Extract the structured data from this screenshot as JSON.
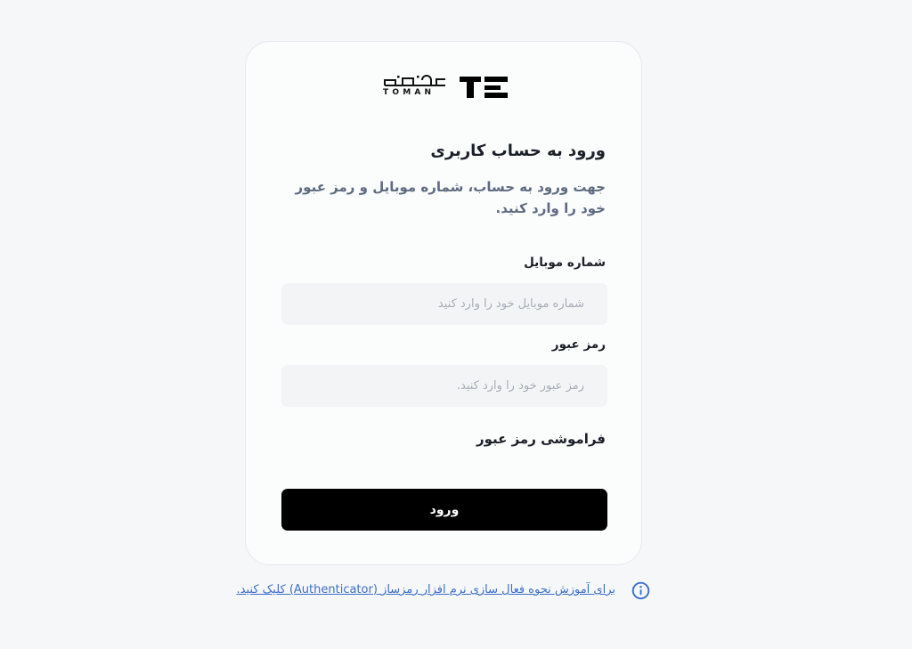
{
  "brand": {
    "name_fa": "تومن",
    "name_en": "TOMAN"
  },
  "login": {
    "title": "ورود به حساب کاربری",
    "subtitle": "جهت ورود به حساب، شماره موبایل و رمز عبور خود را وارد کنید.",
    "mobile": {
      "label": "شماره موبایل",
      "placeholder": "شماره موبایل خود را وارد کنید",
      "value": ""
    },
    "password": {
      "label": "رمز عبور",
      "placeholder": "رمز عبور خود را وارد کنید.",
      "value": ""
    },
    "forgot_label": "فراموشی رمز عبور",
    "submit_label": "ورود"
  },
  "help": {
    "icon": "info-icon",
    "link_text": "برای آموزش نحوه فعال سازی نرم افزار رمزساز (Authenticator) کلیک کنید.",
    "color": "#3d6fc8"
  },
  "colors": {
    "background": "#f6f7f9",
    "card": "#fbfcfc",
    "button": "#000000",
    "field": "#f3f4f6"
  }
}
